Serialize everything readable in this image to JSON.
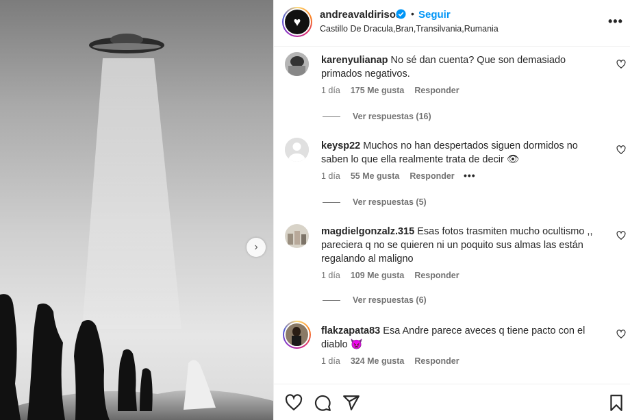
{
  "post": {
    "username": "andreavaldirisos",
    "separator": "•",
    "follow_label": "Seguir",
    "location": "Castillo De Dracula,Bran,Transilvania,Rumania",
    "more_label": "•••"
  },
  "media": {
    "next_label": "›"
  },
  "comments": [
    {
      "username": "karenyulianap",
      "text": "No sé dan cuenta? Que son demasiado primados negativos.",
      "time": "1 día",
      "likes": "175 Me gusta",
      "reply": "Responder",
      "view_replies": "Ver respuestas (16)"
    },
    {
      "username": "keysp22",
      "text": "Muchos no han despertados siguen dormidos no saben lo que ella realmente trata de decir 👁",
      "time": "1 día",
      "likes": "55 Me gusta",
      "reply": "Responder",
      "options": "•••",
      "view_replies": "Ver respuestas (5)"
    },
    {
      "username": "magdielgonzalz.315",
      "text": "Esas fotos trasmiten mucho ocultismo ,, pareciera q no se quieren ni un poquito sus almas las están regalando al maligno",
      "time": "1 día",
      "likes": "109 Me gusta",
      "reply": "Responder",
      "view_replies": "Ver respuestas (6)"
    },
    {
      "username": "flakzapata83",
      "text": "Esa Andre parece aveces q tiene pacto con el diablo 👿",
      "time": "1 día",
      "likes": "324 Me gusta",
      "reply": "Responder"
    }
  ],
  "colors": {
    "link": "#0095f6",
    "muted": "#737373",
    "text": "#262626",
    "verified": "#0095f6"
  },
  "icons": [
    "like-icon",
    "comment-icon",
    "share-icon",
    "save-icon",
    "verified-icon",
    "heart-icon"
  ]
}
